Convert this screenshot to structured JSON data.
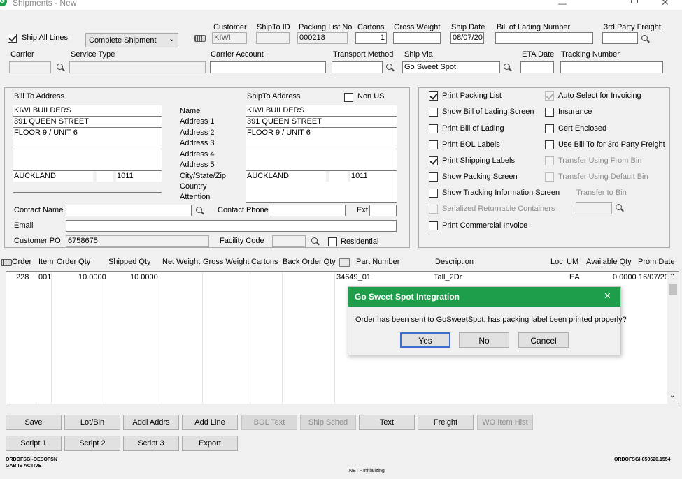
{
  "window": {
    "title": "Shipments - New",
    "app_icon": "green-logo-icon"
  },
  "header": {
    "ship_all_lines": {
      "label": "Ship All Lines",
      "checked": true
    },
    "shipment_type": "Complete Shipment",
    "labels": {
      "customer": "Customer",
      "shipto_id": "ShipTo ID",
      "packing_list_no": "Packing List No",
      "cartons": "Cartons",
      "gross_weight": "Gross Weight",
      "ship_date": "Ship Date",
      "bill_of_lading": "Bill of Lading Number",
      "third_party": "3rd Party Freight",
      "carrier": "Carrier",
      "service_type": "Service Type",
      "carrier_account": "Carrier Account",
      "transport_method": "Transport Method",
      "ship_via": "Ship Via",
      "eta_date": "ETA Date",
      "tracking_number": "Tracking Number"
    },
    "values": {
      "customer": "KIWI",
      "shipto_id": "",
      "packing_list_no": "000218",
      "cartons": "1",
      "gross_weight": "",
      "ship_date": "08/07/20",
      "bill_of_lading": "",
      "third_party": "",
      "carrier": "",
      "service_type": "",
      "carrier_account": "",
      "transport_method": "",
      "ship_via": "Go Sweet Spot",
      "eta_date": "",
      "tracking_number": ""
    }
  },
  "address": {
    "bill_to_title": "Bill To Address",
    "ship_to_title": "ShipTo Address",
    "non_us": {
      "label": "Non US",
      "checked": false
    },
    "row_labels": [
      "Name",
      "Address 1",
      "Address 2",
      "Address 3",
      "Address 4",
      "Address 5",
      "City/State/Zip",
      "Country",
      "Attention"
    ],
    "bill_to": {
      "lines": [
        "KIWI BUILDERS",
        "391 QUEEN STREET",
        "FLOOR 9 / UNIT 6",
        "",
        ""
      ],
      "city": "AUCKLAND",
      "state": "",
      "zip": "1011"
    },
    "ship_to": {
      "lines": [
        "KIWI BUILDERS",
        "391 QUEEN STREET",
        "FLOOR 9 / UNIT 6",
        "",
        "",
        ""
      ],
      "city": "AUCKLAND",
      "state": "",
      "zip": "1011",
      "country": "",
      "attention": ""
    },
    "contact_name_label": "Contact Name",
    "contact_name": "",
    "contact_phone_label": "Contact Phone",
    "contact_phone": "",
    "ext_label": "Ext",
    "ext": "",
    "email_label": "Email",
    "email": "",
    "customer_po_label": "Customer PO",
    "customer_po": "6758675",
    "facility_code_label": "Facility Code",
    "facility_code": "",
    "residential": {
      "label": "Residential",
      "checked": false
    }
  },
  "options": {
    "left": [
      {
        "label": "Print Packing List",
        "checked": true,
        "enabled": true
      },
      {
        "label": "Show Bill of Lading Screen",
        "checked": false,
        "enabled": true
      },
      {
        "label": "Print Bill of Lading",
        "checked": false,
        "enabled": true
      },
      {
        "label": "Print BOL Labels",
        "checked": false,
        "enabled": true
      },
      {
        "label": "Print Shipping Labels",
        "checked": true,
        "enabled": true
      },
      {
        "label": "Show Packing Screen",
        "checked": false,
        "enabled": true
      },
      {
        "label": "Show Tracking Information Screen",
        "checked": false,
        "enabled": true
      },
      {
        "label": "Serialized Returnable Containers",
        "checked": false,
        "enabled": false
      },
      {
        "label": "Print Commercial Invoice",
        "checked": false,
        "enabled": true
      }
    ],
    "right": [
      {
        "label": "Auto Select for Invoicing",
        "checked": true,
        "enabled": false
      },
      {
        "label": "Insurance",
        "checked": false,
        "enabled": true
      },
      {
        "label": "Cert Enclosed",
        "checked": false,
        "enabled": true
      },
      {
        "label": "Use Bill To for 3rd Party Freight",
        "checked": false,
        "enabled": true
      },
      {
        "label": "Transfer Using From Bin",
        "checked": false,
        "enabled": false
      },
      {
        "label": "Transfer Using Default Bin",
        "checked": false,
        "enabled": false
      }
    ],
    "transfer_to_bin_label": "Transfer to Bin",
    "transfer_to_bin": ""
  },
  "grid": {
    "columns": [
      "Order",
      "Item",
      "Order Qty",
      "Shipped Qty",
      "Net Weight",
      "Gross Weight",
      "Cartons",
      "Back Order Qty",
      "Part Number",
      "Description",
      "Loc",
      "UM",
      "Available Qty",
      "Prom Date"
    ],
    "rows": [
      {
        "order": "228",
        "item": "001",
        "order_qty": "10.0000",
        "shipped_qty": "10.0000",
        "net_weight": "",
        "gross_weight": "",
        "cartons": "",
        "back_order_qty": "",
        "part_number": "34649_01",
        "description": "Tall_2Dr",
        "loc": "",
        "um": "EA",
        "available_qty": "0.0000",
        "prom_date": "16/07/20"
      }
    ]
  },
  "buttons_row1": [
    {
      "label": "Save",
      "enabled": true
    },
    {
      "label": "Lot/Bin",
      "enabled": true
    },
    {
      "label": "Addl Addrs",
      "enabled": true
    },
    {
      "label": "Add Line",
      "enabled": true
    },
    {
      "label": "BOL Text",
      "enabled": false
    },
    {
      "label": "Ship Sched",
      "enabled": false
    },
    {
      "label": "Text",
      "enabled": true
    },
    {
      "label": "Freight",
      "enabled": true
    },
    {
      "label": "WO Item Hist",
      "enabled": false
    }
  ],
  "buttons_row2": [
    {
      "label": "Script 1",
      "enabled": true
    },
    {
      "label": "Script 2",
      "enabled": true
    },
    {
      "label": "Script 3",
      "enabled": true
    },
    {
      "label": "Export",
      "enabled": true
    }
  ],
  "status": {
    "left_line1": "ORDOFSGI-OESOFSN",
    "left_line2": "GAB IS ACTIVE",
    "center": ".NET - Initializing",
    "right": "ORDOFSGI-050620.1554"
  },
  "dialog": {
    "title": "Go Sweet Spot Integration",
    "message": "Order has been sent to GoSweetSpot, has packing label been printed properly?",
    "yes": "Yes",
    "no": "No",
    "cancel": "Cancel"
  },
  "colors": {
    "dialog_header": "#1e9e4a",
    "window_bg": "#f0f0f0",
    "app_icon": "#1e9e4a"
  }
}
